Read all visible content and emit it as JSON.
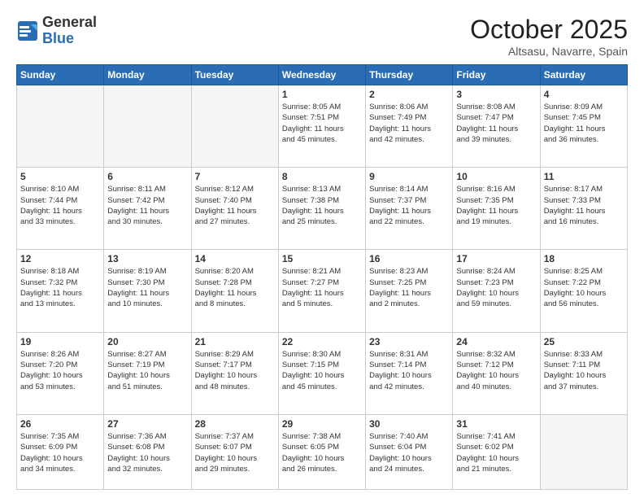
{
  "header": {
    "logo_general": "General",
    "logo_blue": "Blue",
    "month": "October 2025",
    "location": "Altsasu, Navarre, Spain"
  },
  "weekdays": [
    "Sunday",
    "Monday",
    "Tuesday",
    "Wednesday",
    "Thursday",
    "Friday",
    "Saturday"
  ],
  "weeks": [
    [
      {
        "day": "",
        "info": ""
      },
      {
        "day": "",
        "info": ""
      },
      {
        "day": "",
        "info": ""
      },
      {
        "day": "1",
        "info": "Sunrise: 8:05 AM\nSunset: 7:51 PM\nDaylight: 11 hours\nand 45 minutes."
      },
      {
        "day": "2",
        "info": "Sunrise: 8:06 AM\nSunset: 7:49 PM\nDaylight: 11 hours\nand 42 minutes."
      },
      {
        "day": "3",
        "info": "Sunrise: 8:08 AM\nSunset: 7:47 PM\nDaylight: 11 hours\nand 39 minutes."
      },
      {
        "day": "4",
        "info": "Sunrise: 8:09 AM\nSunset: 7:45 PM\nDaylight: 11 hours\nand 36 minutes."
      }
    ],
    [
      {
        "day": "5",
        "info": "Sunrise: 8:10 AM\nSunset: 7:44 PM\nDaylight: 11 hours\nand 33 minutes."
      },
      {
        "day": "6",
        "info": "Sunrise: 8:11 AM\nSunset: 7:42 PM\nDaylight: 11 hours\nand 30 minutes."
      },
      {
        "day": "7",
        "info": "Sunrise: 8:12 AM\nSunset: 7:40 PM\nDaylight: 11 hours\nand 27 minutes."
      },
      {
        "day": "8",
        "info": "Sunrise: 8:13 AM\nSunset: 7:38 PM\nDaylight: 11 hours\nand 25 minutes."
      },
      {
        "day": "9",
        "info": "Sunrise: 8:14 AM\nSunset: 7:37 PM\nDaylight: 11 hours\nand 22 minutes."
      },
      {
        "day": "10",
        "info": "Sunrise: 8:16 AM\nSunset: 7:35 PM\nDaylight: 11 hours\nand 19 minutes."
      },
      {
        "day": "11",
        "info": "Sunrise: 8:17 AM\nSunset: 7:33 PM\nDaylight: 11 hours\nand 16 minutes."
      }
    ],
    [
      {
        "day": "12",
        "info": "Sunrise: 8:18 AM\nSunset: 7:32 PM\nDaylight: 11 hours\nand 13 minutes."
      },
      {
        "day": "13",
        "info": "Sunrise: 8:19 AM\nSunset: 7:30 PM\nDaylight: 11 hours\nand 10 minutes."
      },
      {
        "day": "14",
        "info": "Sunrise: 8:20 AM\nSunset: 7:28 PM\nDaylight: 11 hours\nand 8 minutes."
      },
      {
        "day": "15",
        "info": "Sunrise: 8:21 AM\nSunset: 7:27 PM\nDaylight: 11 hours\nand 5 minutes."
      },
      {
        "day": "16",
        "info": "Sunrise: 8:23 AM\nSunset: 7:25 PM\nDaylight: 11 hours\nand 2 minutes."
      },
      {
        "day": "17",
        "info": "Sunrise: 8:24 AM\nSunset: 7:23 PM\nDaylight: 10 hours\nand 59 minutes."
      },
      {
        "day": "18",
        "info": "Sunrise: 8:25 AM\nSunset: 7:22 PM\nDaylight: 10 hours\nand 56 minutes."
      }
    ],
    [
      {
        "day": "19",
        "info": "Sunrise: 8:26 AM\nSunset: 7:20 PM\nDaylight: 10 hours\nand 53 minutes."
      },
      {
        "day": "20",
        "info": "Sunrise: 8:27 AM\nSunset: 7:19 PM\nDaylight: 10 hours\nand 51 minutes."
      },
      {
        "day": "21",
        "info": "Sunrise: 8:29 AM\nSunset: 7:17 PM\nDaylight: 10 hours\nand 48 minutes."
      },
      {
        "day": "22",
        "info": "Sunrise: 8:30 AM\nSunset: 7:15 PM\nDaylight: 10 hours\nand 45 minutes."
      },
      {
        "day": "23",
        "info": "Sunrise: 8:31 AM\nSunset: 7:14 PM\nDaylight: 10 hours\nand 42 minutes."
      },
      {
        "day": "24",
        "info": "Sunrise: 8:32 AM\nSunset: 7:12 PM\nDaylight: 10 hours\nand 40 minutes."
      },
      {
        "day": "25",
        "info": "Sunrise: 8:33 AM\nSunset: 7:11 PM\nDaylight: 10 hours\nand 37 minutes."
      }
    ],
    [
      {
        "day": "26",
        "info": "Sunrise: 7:35 AM\nSunset: 6:09 PM\nDaylight: 10 hours\nand 34 minutes."
      },
      {
        "day": "27",
        "info": "Sunrise: 7:36 AM\nSunset: 6:08 PM\nDaylight: 10 hours\nand 32 minutes."
      },
      {
        "day": "28",
        "info": "Sunrise: 7:37 AM\nSunset: 6:07 PM\nDaylight: 10 hours\nand 29 minutes."
      },
      {
        "day": "29",
        "info": "Sunrise: 7:38 AM\nSunset: 6:05 PM\nDaylight: 10 hours\nand 26 minutes."
      },
      {
        "day": "30",
        "info": "Sunrise: 7:40 AM\nSunset: 6:04 PM\nDaylight: 10 hours\nand 24 minutes."
      },
      {
        "day": "31",
        "info": "Sunrise: 7:41 AM\nSunset: 6:02 PM\nDaylight: 10 hours\nand 21 minutes."
      },
      {
        "day": "",
        "info": ""
      }
    ]
  ]
}
